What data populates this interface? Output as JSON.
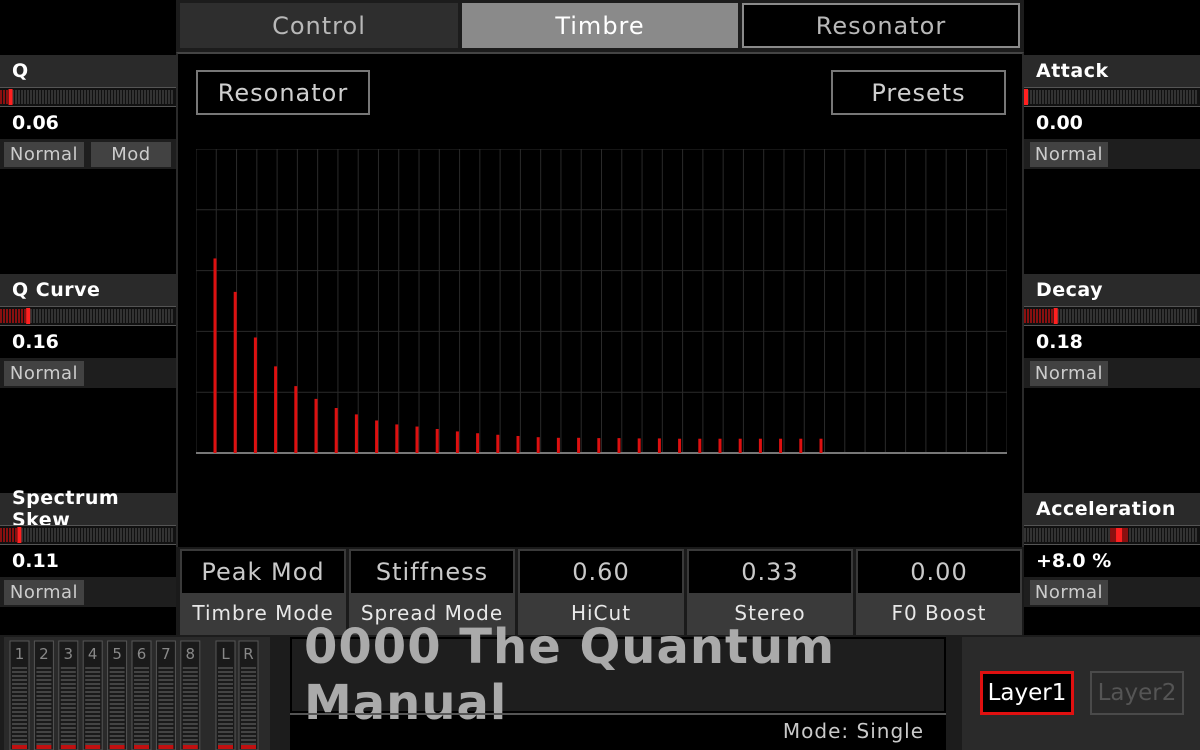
{
  "tabs": [
    {
      "label": "Control",
      "active": false
    },
    {
      "label": "Timbre",
      "active": true
    },
    {
      "label": "Resonator",
      "active": false
    }
  ],
  "header": {
    "resonator_label": "Resonator",
    "presets_label": "Presets"
  },
  "spectrum": {
    "bar_color": "#dd1010",
    "grid_columns": 40,
    "grid_rows": 5,
    "partials": [
      0.64,
      0.53,
      0.38,
      0.285,
      0.22,
      0.178,
      0.148,
      0.127,
      0.107,
      0.094,
      0.087,
      0.079,
      0.071,
      0.065,
      0.06,
      0.056,
      0.052,
      0.05,
      0.05,
      0.049,
      0.049,
      0.048,
      0.048,
      0.047,
      0.047,
      0.047,
      0.047,
      0.047,
      0.047,
      0.047,
      0.047
    ]
  },
  "params": [
    {
      "value": "Peak Mod",
      "label": "Timbre Mode"
    },
    {
      "value": "Stiffness",
      "label": "Spread Mode"
    },
    {
      "value": "0.60",
      "label": "HiCut"
    },
    {
      "value": "0.33",
      "label": "Stereo"
    },
    {
      "value": "0.00",
      "label": "F0 Boost"
    }
  ],
  "left_controls": [
    {
      "title": "Q",
      "value": "0.06",
      "level": 0.06,
      "buttons": [
        "Normal",
        "Mod"
      ]
    },
    {
      "title": "Q Curve",
      "value": "0.16",
      "level": 0.16,
      "buttons": [
        "Normal"
      ]
    },
    {
      "title": "Spectrum Skew",
      "value": "0.11",
      "level": 0.11,
      "buttons": [
        "Normal"
      ]
    }
  ],
  "right_controls": [
    {
      "title": "Attack",
      "value": "0.00",
      "level": 0.0,
      "buttons": [
        "Normal"
      ]
    },
    {
      "title": "Decay",
      "value": "0.18",
      "level": 0.18,
      "buttons": [
        "Normal"
      ]
    },
    {
      "title": "Acceleration",
      "value": "+8.0 %",
      "level": 0.54,
      "buttons": [
        "Normal"
      ]
    }
  ],
  "mixer": {
    "channels": [
      "1",
      "2",
      "3",
      "4",
      "5",
      "6",
      "7",
      "8"
    ],
    "master": [
      "L",
      "R"
    ]
  },
  "preset": {
    "name": "0000 The Quantum Manual",
    "mode": "Mode: Single"
  },
  "layers": [
    {
      "label": "Layer1",
      "active": true
    },
    {
      "label": "Layer2",
      "active": false
    }
  ]
}
